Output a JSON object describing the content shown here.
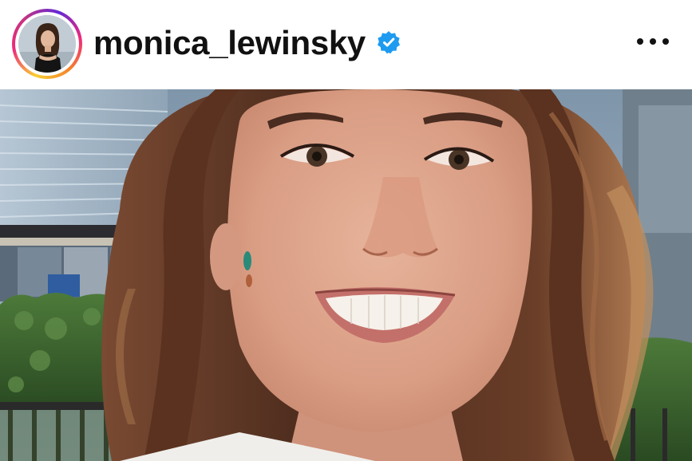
{
  "post_header": {
    "username": "monica_lewinsky",
    "verified": true,
    "verified_badge_icon": "verified-badge-icon",
    "more_icon": "more-options-icon",
    "avatar_icon": "profile-avatar",
    "story_ring_colors": [
      "#f9ce34",
      "#ee2a7b",
      "#6228d7"
    ]
  },
  "post_media": {
    "type": "photo",
    "icon": "post-photo"
  },
  "colors": {
    "verified_blue": "#1e9bf0",
    "text": "#111111",
    "background": "#ffffff"
  }
}
